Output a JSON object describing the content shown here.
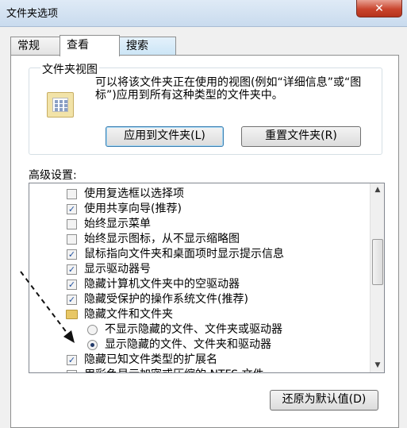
{
  "window": {
    "title": "文件夹选项",
    "close_glyph": "✕"
  },
  "tabs": [
    {
      "label": "常规"
    },
    {
      "label": "查看"
    },
    {
      "label": "搜索"
    }
  ],
  "folder_view": {
    "legend": "文件夹视图",
    "description": "可以将该文件夹正在使用的视图(例如“详细信息”或“图标”)应用到所有这种类型的文件夹中。",
    "apply_button": "应用到文件夹(L)",
    "reset_button": "重置文件夹(R)"
  },
  "advanced": {
    "label": "高级设置:",
    "items": [
      {
        "type": "checkbox",
        "checked": false,
        "label": "使用复选框以选择项"
      },
      {
        "type": "checkbox",
        "checked": true,
        "label": "使用共享向导(推荐)"
      },
      {
        "type": "checkbox",
        "checked": false,
        "label": "始终显示菜单"
      },
      {
        "type": "checkbox",
        "checked": false,
        "label": "始终显示图标，从不显示缩略图"
      },
      {
        "type": "checkbox",
        "checked": true,
        "label": "鼠标指向文件夹和桌面项时显示提示信息"
      },
      {
        "type": "checkbox",
        "checked": true,
        "label": "显示驱动器号"
      },
      {
        "type": "checkbox",
        "checked": true,
        "label": "隐藏计算机文件夹中的空驱动器"
      },
      {
        "type": "checkbox",
        "checked": true,
        "label": "隐藏受保护的操作系统文件(推荐)"
      },
      {
        "type": "folder",
        "label": "隐藏文件和文件夹"
      },
      {
        "type": "radio",
        "checked": false,
        "label": "不显示隐藏的文件、文件夹或驱动器"
      },
      {
        "type": "radio",
        "checked": true,
        "label": "显示隐藏的文件、文件夹和驱动器"
      },
      {
        "type": "checkbox",
        "checked": true,
        "label": "隐藏已知文件类型的扩展名"
      },
      {
        "type": "checkbox",
        "checked": true,
        "label": "用彩色显示加密或压缩的 NTFS 文件"
      }
    ],
    "restore_button": "还原为默认值(D)"
  }
}
